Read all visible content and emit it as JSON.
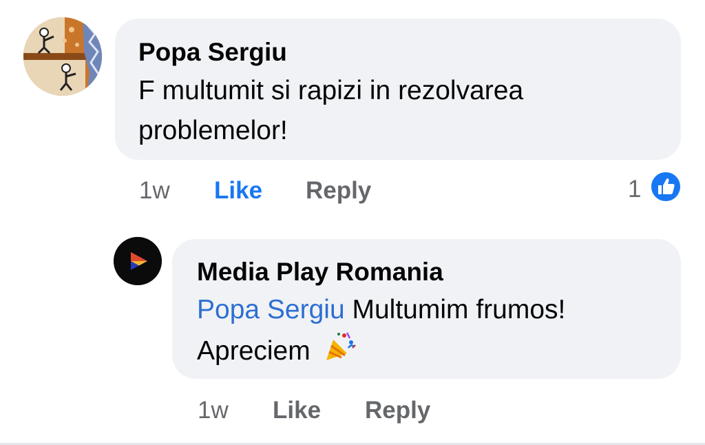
{
  "comment": {
    "author": "Popa Sergiu",
    "text": "F multumit si rapizi in rezolvarea problemelor!",
    "time": "1w",
    "like_label": "Like",
    "reply_label": "Reply",
    "reaction_count": "1",
    "like_active": true,
    "avatar_icon": "cartoon-avatar"
  },
  "reply": {
    "author": "Media Play Romania",
    "mention": "Popa Sergiu",
    "text": "Multumim frumos! Apreciem",
    "emoji_icon": "party-popper-icon",
    "time": "1w",
    "like_label": "Like",
    "reply_label": "Reply",
    "avatar_icon": "play-logo-icon"
  },
  "colors": {
    "bubble": "#f0f2f5",
    "link_blue": "#1877f2",
    "mention_blue": "#2d6fd2",
    "meta_gray": "#65676b"
  }
}
